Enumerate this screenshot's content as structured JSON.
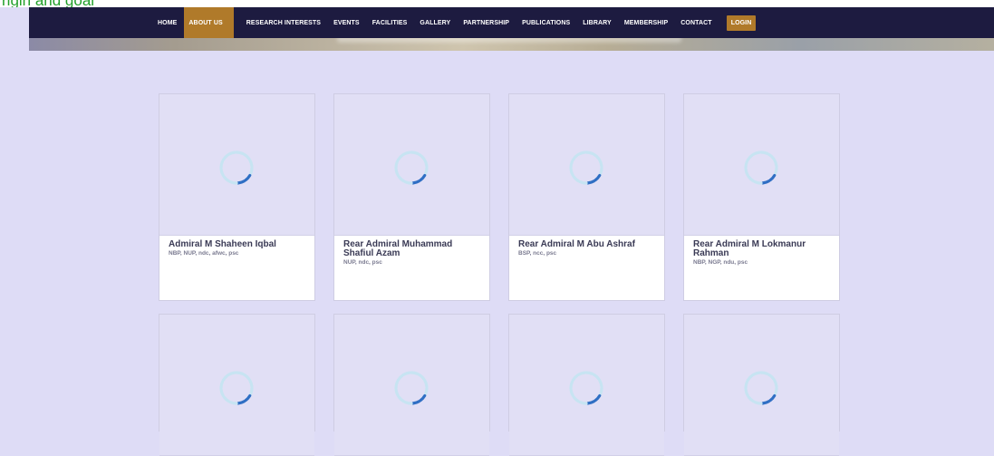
{
  "top_strip_text": "rigin and goal",
  "nav": {
    "items": [
      {
        "label": "Home",
        "active": false
      },
      {
        "label": "About Us",
        "active": true
      },
      {
        "label": "Research Interests",
        "active": false
      },
      {
        "label": "Events",
        "active": false
      },
      {
        "label": "Facilities",
        "active": false
      },
      {
        "label": "Gallery",
        "active": false
      },
      {
        "label": "Partnership",
        "active": false
      },
      {
        "label": "Publications",
        "active": false
      },
      {
        "label": "Library",
        "active": false
      },
      {
        "label": "Membership",
        "active": false
      },
      {
        "label": "Contact",
        "active": false
      }
    ],
    "login_label": "Login",
    "accent_color": "#b07a2a",
    "bar_color": "#1d1b40"
  },
  "members": [
    {
      "name": "Admiral M Shaheen Iqbal",
      "titles": "NBP, NUP, ndc, afwc, psc"
    },
    {
      "name": "Rear Admiral Muhammad Shafiul Azam",
      "titles": "NUP, ndc, psc"
    },
    {
      "name": "Rear Admiral M Abu Ashraf",
      "titles": "BSP, ncc, psc"
    },
    {
      "name": "Rear Admiral M Lokmanur Rahman",
      "titles": "NBP, NGP, ndu, psc"
    },
    {
      "name": "",
      "titles": ""
    },
    {
      "name": "",
      "titles": ""
    },
    {
      "name": "",
      "titles": ""
    },
    {
      "name": "",
      "titles": ""
    }
  ],
  "icons": {
    "loading": "loading-spinner-icon"
  }
}
